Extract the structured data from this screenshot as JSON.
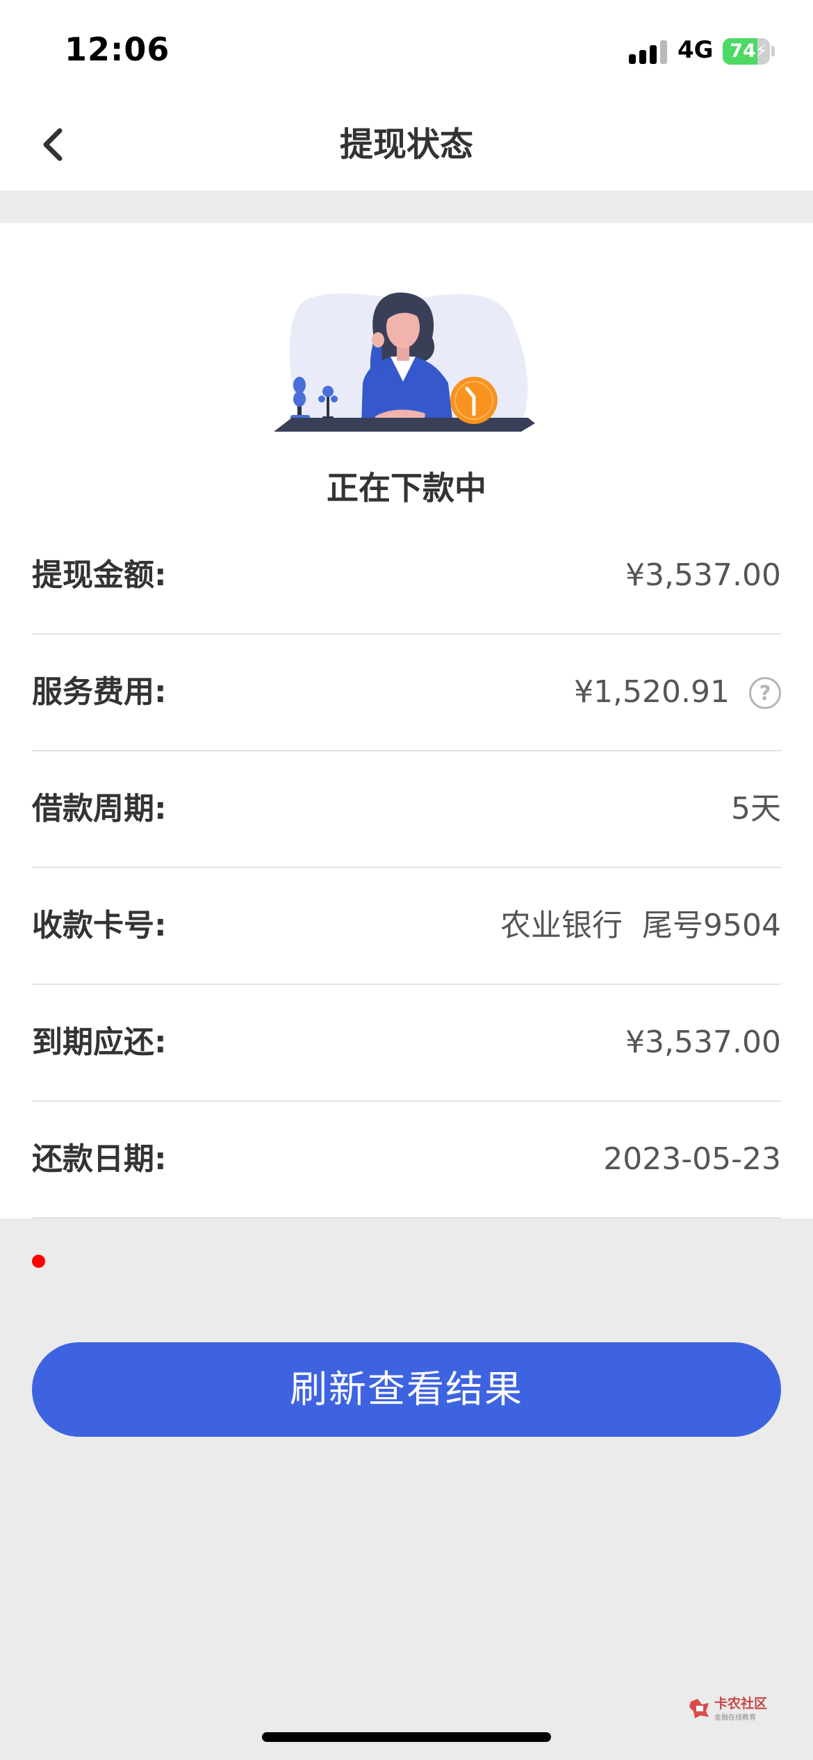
{
  "status_bar": {
    "time": "12:06",
    "network": "4G",
    "battery_level": "74",
    "battery_percent": 74,
    "battery_color": "#4cd964"
  },
  "nav": {
    "back_icon": "chevron-left-icon",
    "title": "提现状态"
  },
  "status": {
    "illustration": "woman-waiting-clock-illustration",
    "heading": "正在下款中"
  },
  "details": [
    {
      "label": "提现金额:",
      "value": "¥3,537.00"
    },
    {
      "label": "服务费用:",
      "value": "¥1,520.91",
      "help_icon": "question-circle-icon",
      "help_glyph": "?"
    },
    {
      "label": "借款周期:",
      "value": "5天"
    },
    {
      "label": "收款卡号:",
      "value": "农业银行  尾号9504"
    },
    {
      "label": "到期应还:",
      "value": "¥3,537.00"
    },
    {
      "label": "还款日期:",
      "value": "2023-05-23"
    }
  ],
  "action": {
    "refresh_label": "刷新查看结果",
    "button_color": "#3d63e0"
  },
  "watermark": {
    "title": "卡农社区",
    "subtitle": "金融在线教育"
  }
}
